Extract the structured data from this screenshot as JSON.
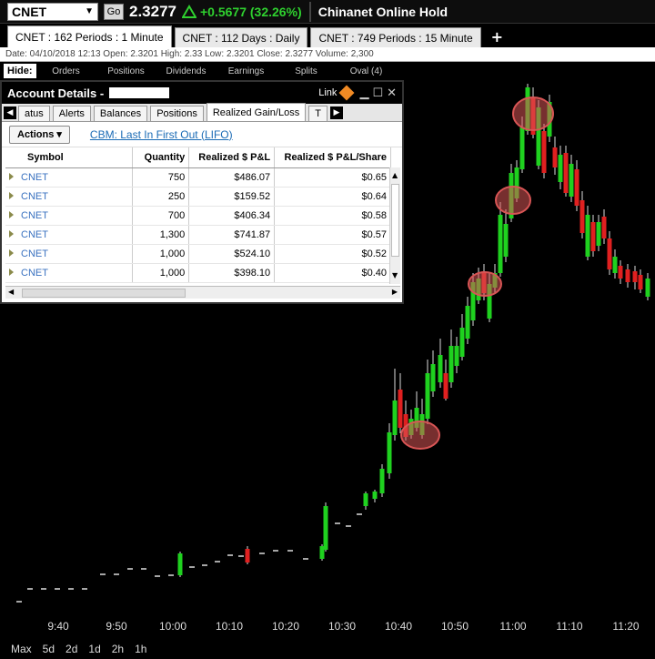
{
  "ticker": {
    "symbol": "CNET",
    "go_label": "Go",
    "price": "2.3277",
    "change": "+0.5677 (32.26%)",
    "company": "Chinanet Online Hold"
  },
  "chart_tabs": [
    {
      "label": "CNET : 162  Periods : 1 Minute",
      "active": true
    },
    {
      "label": "CNET : 112  Days : Daily",
      "active": false
    },
    {
      "label": "CNET : 749  Periods : 15 Minute",
      "active": false
    }
  ],
  "add_tab_label": "+",
  "info_line": "Date: 04/10/2018 12:13   Open: 2.3201   High: 2.33   Low: 2.3201   Close: 2.3277   Volume: 2,300",
  "study_tabs": {
    "hide_label": "Hide:",
    "items": [
      "Orders",
      "Positions",
      "Dividends",
      "Earnings",
      "Splits",
      "Oval (4)"
    ]
  },
  "panel": {
    "title": "Account Details -",
    "link_label": "Link",
    "tabs": [
      "atus",
      "Alerts",
      "Balances",
      "Positions",
      "Realized Gain/Loss",
      "T"
    ],
    "active_tab_index": 4,
    "actions_label": "Actions ▾",
    "cbm_label": "CBM: Last In First Out (LIFO)",
    "columns": [
      "Symbol",
      "Quantity",
      "Realized $ P&L",
      "Realized $ P&L/Share"
    ],
    "rows": [
      [
        "CNET",
        "750",
        "$486.07",
        "$0.65"
      ],
      [
        "CNET",
        "250",
        "$159.52",
        "$0.64"
      ],
      [
        "CNET",
        "700",
        "$406.34",
        "$0.58"
      ],
      [
        "CNET",
        "1,300",
        "$741.87",
        "$0.57"
      ],
      [
        "CNET",
        "1,000",
        "$524.10",
        "$0.52"
      ],
      [
        "CNET",
        "1,000",
        "$398.10",
        "$0.40"
      ]
    ]
  },
  "chart_data": {
    "type": "candlestick",
    "x_ticks": [
      "9:40",
      "9:50",
      "10:00",
      "10:10",
      "10:20",
      "10:30",
      "10:40",
      "10:50",
      "11:00",
      "11:10",
      "11:20"
    ],
    "up_color": "#1fd11f",
    "down_color": "#e02020",
    "marker_color": "#d85555",
    "grid": false
  },
  "timeframes": [
    "Max",
    "5d",
    "2d",
    "1d",
    "2h",
    "1h"
  ]
}
